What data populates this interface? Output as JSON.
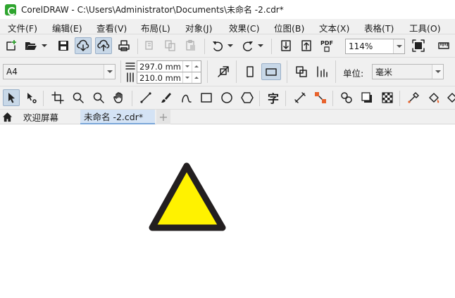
{
  "titlebar": {
    "title": "CorelDRAW - C:\\Users\\Administrator\\Documents\\未命名 -2.cdr*"
  },
  "menu": {
    "items": [
      {
        "label": "文件(F)"
      },
      {
        "label": "编辑(E)"
      },
      {
        "label": "查看(V)"
      },
      {
        "label": "布局(L)"
      },
      {
        "label": "对象(J)"
      },
      {
        "label": "效果(C)"
      },
      {
        "label": "位图(B)"
      },
      {
        "label": "文本(X)"
      },
      {
        "label": "表格(T)"
      },
      {
        "label": "工具(O)"
      }
    ]
  },
  "standard_toolbar": {
    "zoom_value": "114%",
    "pdf_label": "PDF"
  },
  "property_bar": {
    "page_size": "A4",
    "width_value": "297.0 mm",
    "height_value": "210.0 mm",
    "units_label": "单位:",
    "units_value": "毫米"
  },
  "toolbox": {
    "text_tool_glyph": "字"
  },
  "tabs": {
    "items": [
      {
        "label": "欢迎屏幕",
        "active": false
      },
      {
        "label": "未命名 -2.cdr*",
        "active": true
      }
    ],
    "add_label": "+"
  },
  "canvas": {
    "shape": "triangle",
    "fill_color": "#fff200",
    "stroke_color": "#231f20"
  },
  "colors": {
    "accent": "#d4e3f5",
    "chrome": "#f0f0f0",
    "logo": "#2fa52f"
  }
}
